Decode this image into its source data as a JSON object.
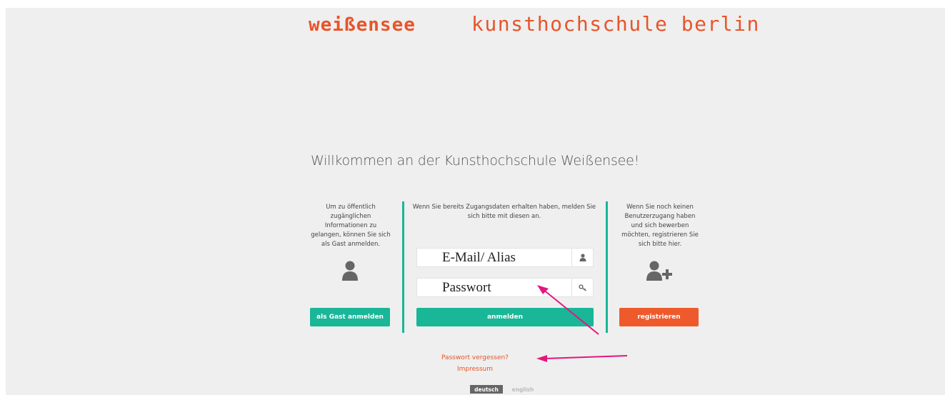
{
  "header": {
    "logo_left": "weißensee",
    "logo_right": "kunsthochschule berlin"
  },
  "welcome": "Willkommen an der Kunsthochschule Weißensee!",
  "guest": {
    "text_lines": [
      "Um zu öffentlich",
      "zugänglichen",
      "Informationen zu",
      "gelangen, können Sie sich",
      "als Gast anmelden."
    ],
    "button": "als Gast anmelden",
    "icon": "user-icon"
  },
  "login": {
    "text_lines": [
      "Wenn Sie bereits Zugangsdaten erhalten haben, melden Sie",
      "sich bitte mit diesen an."
    ],
    "email_placeholder": "E-Mail/ Alias",
    "password_placeholder": "Passwort",
    "button": "anmelden"
  },
  "register": {
    "text_lines": [
      "Wenn Sie noch keinen",
      "Benutzerzugang haben",
      "und sich bewerben",
      "möchten, registrieren Sie",
      "sich bitte hier."
    ],
    "button": "registrieren",
    "icon": "add-user-icon"
  },
  "links": {
    "forgot": "Passwort vergessen?",
    "impressum": "Impressum"
  },
  "languages": {
    "active": "deutsch",
    "inactive": "english"
  },
  "colors": {
    "brand_orange": "#e8542b",
    "teal": "#19b698",
    "annotation_arrow": "#e6157f"
  }
}
